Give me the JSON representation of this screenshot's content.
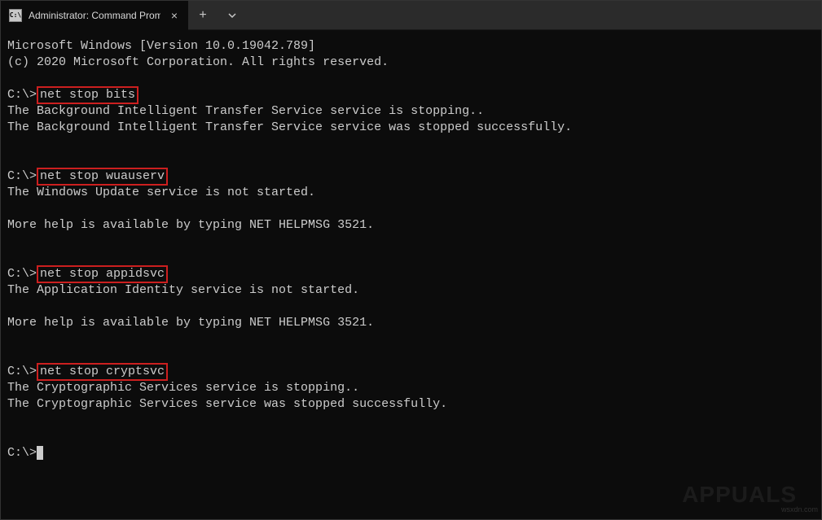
{
  "tab": {
    "title": "Administrator: Command Promp",
    "close": "×"
  },
  "tabbar": {
    "plus": "+",
    "chevron": "⌄"
  },
  "terminal": {
    "header1": "Microsoft Windows [Version 10.0.19042.789]",
    "header2": "(c) 2020 Microsoft Corporation. All rights reserved.",
    "prompt": "C:\\>",
    "cmd1": "net stop bits",
    "out1a": "The Background Intelligent Transfer Service service is stopping..",
    "out1b": "The Background Intelligent Transfer Service service was stopped successfully.",
    "cmd2": "net stop wuauserv",
    "out2a": "The Windows Update service is not started.",
    "out2b": "More help is available by typing NET HELPMSG 3521.",
    "cmd3": "net stop appidsvc",
    "out3a": "The Application Identity service is not started.",
    "out3b": "More help is available by typing NET HELPMSG 3521.",
    "cmd4": "net stop cryptsvc",
    "out4a": "The Cryptographic Services service is stopping..",
    "out4b": "The Cryptographic Services service was stopped successfully."
  },
  "watermark": "APPUALS",
  "footer": "wsxdn.com"
}
